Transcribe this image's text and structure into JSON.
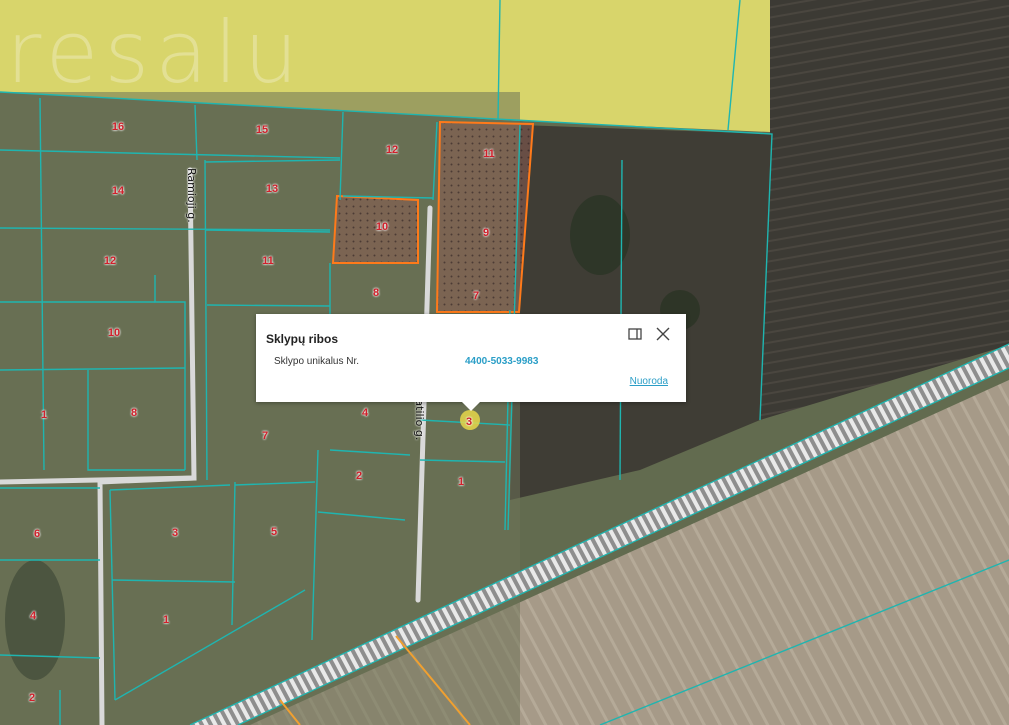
{
  "watermark": "resalu",
  "streets": {
    "ramioji": "Ramioji g.",
    "ratilio": "Ratilio g."
  },
  "parcel_numbers": [
    "16",
    "15",
    "12",
    "11",
    "14",
    "13",
    "10",
    "9",
    "12",
    "11",
    "8",
    "7",
    "10",
    "4",
    "1",
    "8",
    "7",
    "2",
    "1",
    "6",
    "3",
    "5",
    "4",
    "1",
    "2",
    "3"
  ],
  "popup": {
    "title": "Sklypų ribos",
    "label": "Sklypo unikalus Nr.",
    "value": "4400-5033-9983",
    "link": "Nuoroda",
    "expand_icon": "expand-icon",
    "close_icon": "close-icon"
  },
  "colors": {
    "parcel_border": "#1fb5b0",
    "selected_border": "#ff7a1a",
    "label_red": "#d0202b",
    "field_yellow": "#d9d66a"
  }
}
